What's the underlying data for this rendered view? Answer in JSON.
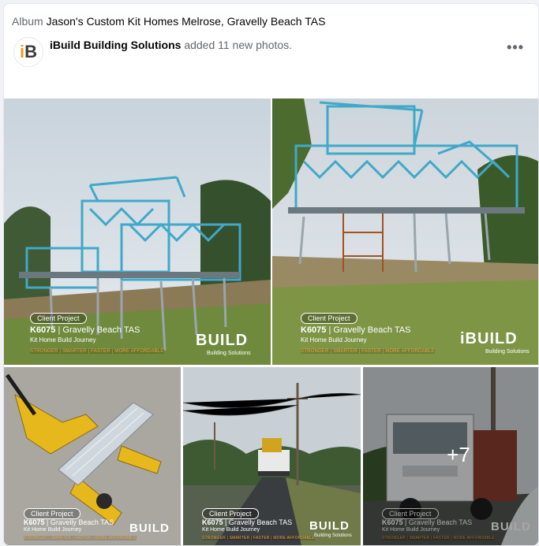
{
  "album": {
    "prefix": "Album",
    "title": "Jason's Custom Kit Homes Melrose, Gravelly Beach TAS"
  },
  "post": {
    "author": "iBuild Building Solutions",
    "action": "added 11 new photos.",
    "more_icon": "more-horizontal-icon",
    "avatar_logo": "iB"
  },
  "photos": [
    {
      "client_project": "Client Project",
      "code": "K6075",
      "location": "Gravelly Beach TAS",
      "journey": "Kit Home Build Journey",
      "slogan": "STRONGER | SMARTER | FASTER | MORE AFFORDABLE",
      "brand": "BUILD",
      "brand_sub": "Building Solutions"
    },
    {
      "client_project": "Client Project",
      "code": "K6075",
      "location": "Gravelly Beach TAS",
      "journey": "Kit Home Build Journey",
      "slogan": "STRONGER | SMARTER | FASTER | MORE AFFORDABLE",
      "brand": "iBUILD",
      "brand_sub": "Building Solutions"
    },
    {
      "client_project": "Client Project",
      "code": "K6075",
      "location": "Gravelly Beach TAS",
      "journey": "Kit Home Build Journey",
      "slogan": "STRONGER | SMARTER | FASTER | MORE AFFORDABLE",
      "brand": "BUILD",
      "brand_sub": ""
    },
    {
      "client_project": "Client Project",
      "code": "K6075",
      "location": "Gravelly Beach TAS",
      "journey": "Kit Home Build Journey",
      "slogan": "STRONGER | SMARTER | FASTER | MORE AFFORDABLE",
      "brand": "BUILD",
      "brand_sub": "Building Solutions"
    },
    {
      "client_project": "Client Project",
      "code": "K6075",
      "location": "Gravelly Beach TAS",
      "journey": "Kit Home Build Journey",
      "slogan": "STRONGER | SMARTER | FASTER | MORE AFFORDABLE",
      "brand": "BUILD",
      "brand_sub": "",
      "more_count": "+7"
    }
  ],
  "colors": {
    "frame_blue": "#3fa9c9",
    "accent_orange": "#f29a1f"
  }
}
